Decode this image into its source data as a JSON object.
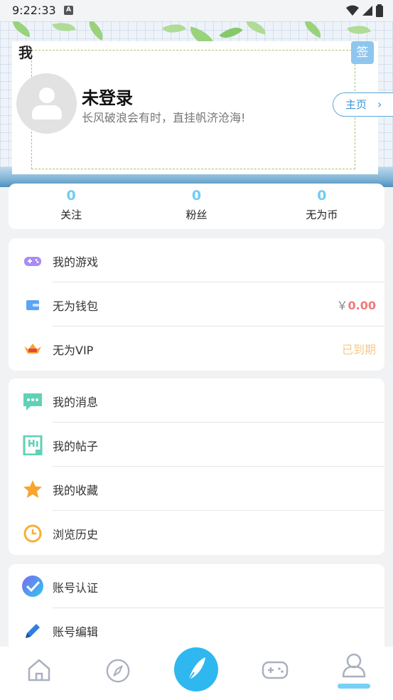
{
  "status_bar": {
    "time": "9:22:33",
    "notification_icon": "A"
  },
  "header": {
    "title": "我",
    "sign_label": "签",
    "user_name": "未登录",
    "motto": "长风破浪会有时，直挂帆济沧海!",
    "home_label": "主页",
    "home_chevron": "›"
  },
  "stats": [
    {
      "value": "0",
      "label": "关注"
    },
    {
      "value": "0",
      "label": "粉丝"
    },
    {
      "value": "0",
      "label": "无为币"
    }
  ],
  "group1": [
    {
      "icon": "gamepad-icon",
      "label": "我的游戏"
    },
    {
      "icon": "wallet-icon",
      "label": "无为钱包",
      "currency": "￥",
      "amount": "0.00"
    },
    {
      "icon": "vip-icon",
      "label": "无为VIP",
      "status": "已到期"
    }
  ],
  "group2": [
    {
      "icon": "message-icon",
      "label": "我的消息"
    },
    {
      "icon": "post-icon",
      "label": "我的帖子"
    },
    {
      "icon": "star-icon",
      "label": "我的收藏"
    },
    {
      "icon": "clock-icon",
      "label": "浏览历史"
    }
  ],
  "group3": [
    {
      "icon": "verify-icon",
      "label": "账号认证"
    },
    {
      "icon": "pencil-icon",
      "label": "账号编辑"
    }
  ],
  "bottom_nav": [
    "home-icon",
    "compass-icon",
    "feather-icon",
    "game-controller-icon",
    "profile-icon"
  ],
  "colors": {
    "accent": "#2fb7f0",
    "stat": "#6fcdf3",
    "amount": "#f2797a",
    "vip_status": "#f8c98a"
  }
}
